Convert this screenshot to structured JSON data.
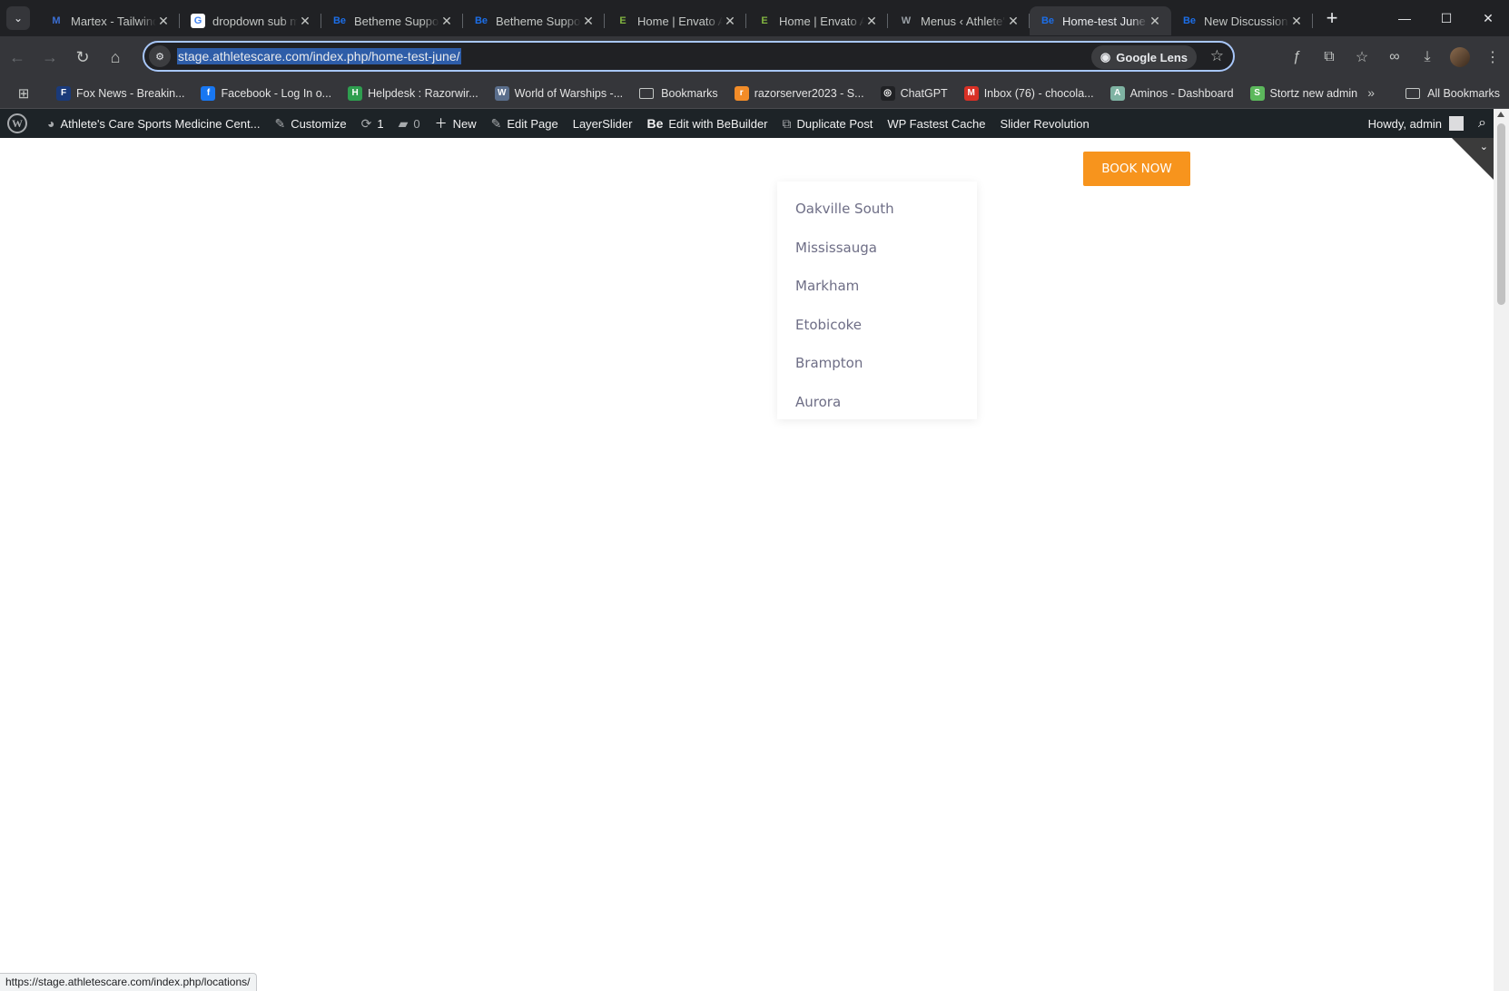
{
  "browser": {
    "tabs": [
      {
        "title": "Martex - Tailwind",
        "favicon": "martex-icon",
        "color": "#3b6fd4",
        "glyph": "M"
      },
      {
        "title": "dropdown sub menu",
        "favicon": "google-icon",
        "color": "#ffffff",
        "glyph": "G"
      },
      {
        "title": "Betheme Support",
        "favicon": "betheme-icon",
        "color": "#1c6ee8",
        "glyph": "Be"
      },
      {
        "title": "Betheme Support",
        "favicon": "betheme-icon",
        "color": "#1c6ee8",
        "glyph": "Be"
      },
      {
        "title": "Home | Envato Account",
        "favicon": "envato-icon",
        "color": "#82b541",
        "glyph": "E"
      },
      {
        "title": "Home | Envato Account",
        "favicon": "envato-icon",
        "color": "#82b541",
        "glyph": "E"
      },
      {
        "title": "Menus ‹ Athlete's Care",
        "favicon": "wordpress-icon",
        "color": "#9aa0a6",
        "glyph": "W"
      },
      {
        "title": "Home-test June",
        "favicon": "betheme-icon",
        "color": "#1c6ee8",
        "glyph": "Be",
        "active": true
      },
      {
        "title": "New Discussion",
        "favicon": "betheme-icon",
        "color": "#1c6ee8",
        "glyph": "Be"
      }
    ],
    "url": "stage.athletescare.com/index.php/home-test-june/",
    "lens_label": "Google Lens",
    "bookmarks": [
      {
        "label": "Fox News - Breakin...",
        "color": "#1a3a7a",
        "glyph": "F"
      },
      {
        "label": "Facebook - Log In o...",
        "color": "#1877f2",
        "glyph": "f"
      },
      {
        "label": "Helpdesk : Razorwir...",
        "color": "#2e9e4f",
        "glyph": "H"
      },
      {
        "label": "World of Warships -...",
        "color": "#5a6e8c",
        "glyph": "W"
      },
      {
        "label": "Bookmarks",
        "color": "folder",
        "glyph": ""
      },
      {
        "label": "razorserver2023 - S...",
        "color": "#f28c28",
        "glyph": "r"
      },
      {
        "label": "ChatGPT",
        "color": "#202124",
        "glyph": "◎"
      },
      {
        "label": "Inbox (76) - chocola...",
        "color": "#d93025",
        "glyph": "M"
      },
      {
        "label": "Aminos - Dashboard",
        "color": "#7fb3a3",
        "glyph": "A"
      },
      {
        "label": "Stortz new admin",
        "color": "#5cb85c",
        "glyph": "S"
      }
    ],
    "all_bookmarks": "All Bookmarks",
    "status_url": "https://stage.athletescare.com/index.php/locations/"
  },
  "adminbar": {
    "site_name": "Athlete's Care Sports Medicine Cent...",
    "customize": "Customize",
    "updates": "1",
    "comments": "0",
    "new": "New",
    "edit_page": "Edit Page",
    "layerslider": "LayerSlider",
    "bebuilder": "Edit with BeBuilder",
    "duplicate": "Duplicate Post",
    "fastest_cache": "WP Fastest Cache",
    "slider_rev": "Slider Revolution",
    "howdy": "Howdy, admin"
  },
  "page": {
    "book_now": "BOOK NOW",
    "book_color": "#f7941d",
    "locations": [
      "Oakville South",
      "Mississauga",
      "Markham",
      "Etobicoke",
      "Brampton",
      "Aurora"
    ]
  }
}
